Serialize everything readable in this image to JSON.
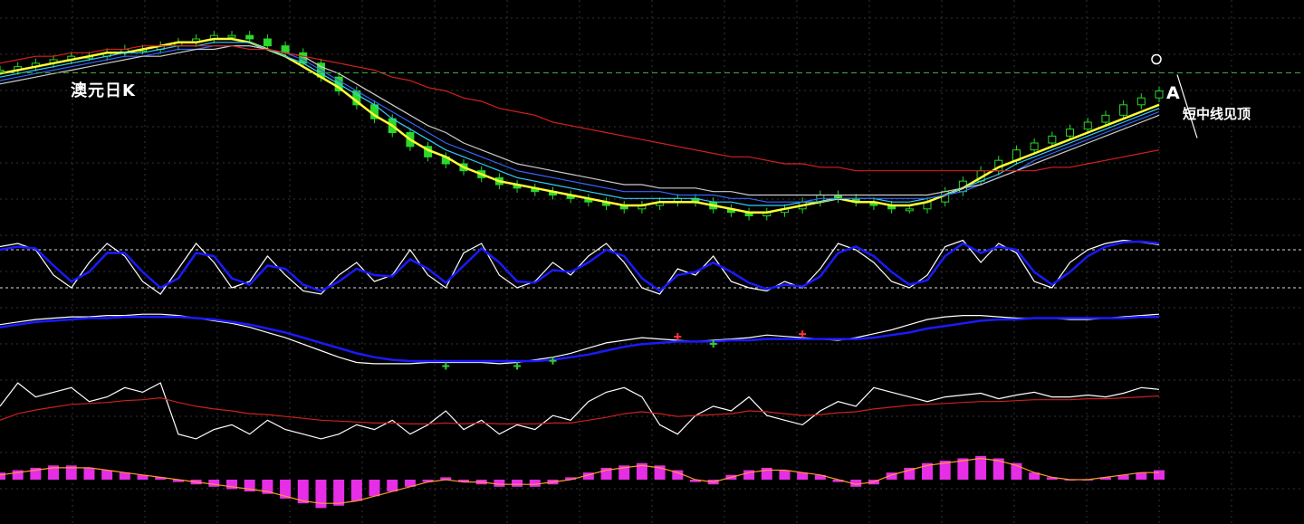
{
  "chart_data": {
    "type": "line",
    "title": "澳元日K",
    "annotations": {
      "point_label": "A",
      "note": "短中线见顶"
    },
    "panels": [
      {
        "name": "price",
        "series": [
          {
            "key": "close",
            "color": "#2bd92b",
            "values": [
              60,
              61,
              62,
              63,
              64,
              64,
              65,
              66,
              66,
              67,
              68,
              69,
              70,
              70,
              69,
              67,
              65,
              62,
              58,
              54,
              50,
              46,
              42,
              38,
              35,
              33,
              31,
              29,
              27,
              26,
              25,
              24,
              23,
              22,
              21,
              20,
              21,
              22,
              23,
              22,
              20,
              19,
              18,
              19,
              20,
              22,
              24,
              23,
              22,
              21,
              20,
              20,
              22,
              25,
              28,
              31,
              34,
              37,
              39,
              41,
              43,
              45,
              47,
              50,
              52,
              54
            ]
          },
          {
            "key": "ma_yellow",
            "color": "#ffff33",
            "values": [
              59,
              60,
              61,
              62,
              63,
              64,
              65,
              65,
              66,
              67,
              68,
              68,
              69,
              69,
              68,
              66,
              64,
              61,
              58,
              55,
              51,
              47,
              44,
              40,
              37,
              35,
              32,
              30,
              28,
              27,
              26,
              25,
              24,
              23,
              22,
              21,
              21,
              22,
              22,
              22,
              21,
              20,
              19,
              19,
              20,
              21,
              22,
              23,
              22,
              22,
              21,
              21,
              22,
              24,
              26,
              29,
              32,
              34,
              36,
              38,
              40,
              42,
              44,
              46,
              48,
              50
            ]
          },
          {
            "key": "ma_cyan",
            "color": "#33ccff",
            "values": [
              58,
              59,
              60,
              61,
              62,
              63,
              64,
              65,
              65,
              66,
              67,
              67,
              68,
              68,
              68,
              66,
              64,
              62,
              59,
              56,
              53,
              50,
              46,
              43,
              40,
              37,
              35,
              33,
              31,
              29,
              28,
              27,
              26,
              25,
              24,
              23,
              23,
              23,
              23,
              23,
              22,
              22,
              21,
              21,
              21,
              22,
              22,
              23,
              23,
              23,
              22,
              22,
              23,
              24,
              26,
              28,
              30,
              33,
              35,
              37,
              39,
              41,
              43,
              45,
              47,
              49
            ]
          },
          {
            "key": "ma_blue",
            "color": "#3366ff",
            "values": [
              57,
              58,
              59,
              60,
              61,
              62,
              63,
              64,
              64,
              65,
              66,
              66,
              67,
              67,
              67,
              66,
              65,
              63,
              60,
              57,
              54,
              51,
              48,
              45,
              42,
              39,
              37,
              35,
              33,
              31,
              30,
              29,
              28,
              27,
              26,
              25,
              25,
              25,
              24,
              24,
              24,
              23,
              23,
              22,
              22,
              22,
              23,
              23,
              23,
              23,
              23,
              23,
              23,
              24,
              25,
              27,
              29,
              31,
              34,
              36,
              38,
              40,
              42,
              44,
              46,
              48
            ]
          },
          {
            "key": "ma_white",
            "color": "#cccccc",
            "values": [
              56,
              57,
              58,
              59,
              60,
              61,
              62,
              63,
              64,
              64,
              65,
              66,
              66,
              67,
              67,
              66,
              65,
              64,
              61,
              59,
              56,
              53,
              50,
              47,
              44,
              42,
              39,
              37,
              35,
              33,
              32,
              31,
              30,
              29,
              28,
              27,
              27,
              26,
              26,
              26,
              25,
              25,
              24,
              24,
              24,
              24,
              24,
              24,
              24,
              24,
              24,
              24,
              24,
              25,
              26,
              27,
              29,
              31,
              33,
              35,
              37,
              39,
              41,
              43,
              45,
              47
            ]
          },
          {
            "key": "ma_red",
            "color": "#d42020",
            "values": [
              62,
              63,
              64,
              64,
              65,
              65,
              66,
              66,
              67,
              67,
              67,
              67,
              67,
              67,
              66,
              66,
              65,
              64,
              63,
              62,
              61,
              60,
              58,
              57,
              55,
              54,
              52,
              51,
              49,
              48,
              47,
              45,
              44,
              43,
              42,
              41,
              40,
              39,
              38,
              37,
              36,
              35,
              35,
              34,
              33,
              33,
              32,
              32,
              31,
              31,
              31,
              31,
              31,
              31,
              31,
              31,
              31,
              31,
              31,
              32,
              32,
              33,
              34,
              35,
              36,
              37
            ]
          }
        ]
      },
      {
        "name": "stochastic",
        "series": [
          {
            "key": "fast",
            "color": "#ffffff",
            "values": [
              85,
              90,
              80,
              40,
              20,
              60,
              90,
              70,
              30,
              10,
              50,
              90,
              60,
              20,
              30,
              70,
              40,
              15,
              10,
              40,
              60,
              30,
              40,
              80,
              40,
              20,
              75,
              90,
              40,
              20,
              30,
              60,
              40,
              70,
              90,
              60,
              20,
              10,
              50,
              40,
              70,
              30,
              20,
              15,
              30,
              20,
              50,
              90,
              80,
              60,
              30,
              20,
              40,
              85,
              95,
              60,
              90,
              75,
              30,
              20,
              60,
              80,
              90,
              95,
              92,
              88
            ]
          },
          {
            "key": "slow",
            "color": "#1a1aff",
            "values": [
              80,
              85,
              82,
              55,
              30,
              45,
              75,
              75,
              45,
              20,
              35,
              75,
              70,
              35,
              25,
              55,
              50,
              25,
              15,
              30,
              50,
              40,
              38,
              65,
              50,
              28,
              55,
              82,
              60,
              30,
              28,
              48,
              45,
              60,
              80,
              70,
              35,
              15,
              40,
              45,
              60,
              45,
              28,
              18,
              25,
              22,
              38,
              75,
              85,
              70,
              45,
              25,
              32,
              70,
              90,
              75,
              85,
              80,
              45,
              25,
              45,
              70,
              85,
              92,
              93,
              90
            ]
          }
        ],
        "reference_lines": [
          80,
          20
        ]
      },
      {
        "name": "trend",
        "series": [
          {
            "key": "fast",
            "color": "#ffffff",
            "values": [
              82,
              84,
              86,
              87,
              88,
              88,
              89,
              89,
              90,
              90,
              89,
              87,
              85,
              83,
              80,
              76,
              72,
              67,
              62,
              57,
              53,
              52,
              52,
              52,
              53,
              53,
              53,
              53,
              52,
              53,
              55,
              57,
              60,
              64,
              68,
              70,
              72,
              71,
              70,
              69,
              70,
              71,
              72,
              74,
              73,
              72,
              71,
              70,
              72,
              75,
              78,
              82,
              86,
              88,
              89,
              89,
              88,
              87,
              87,
              87,
              86,
              86,
              87,
              88,
              89,
              90
            ]
          },
          {
            "key": "slow",
            "color": "#1a1aff",
            "values": [
              80,
              82,
              84,
              85,
              86,
              87,
              87,
              88,
              88,
              88,
              88,
              87,
              86,
              84,
              82,
              79,
              76,
              72,
              68,
              64,
              60,
              57,
              55,
              54,
              54,
              54,
              54,
              54,
              54,
              54,
              54,
              55,
              57,
              59,
              62,
              65,
              67,
              68,
              69,
              69,
              69,
              70,
              70,
              71,
              71,
              71,
              71,
              71,
              71,
              72,
              74,
              76,
              79,
              81,
              83,
              85,
              86,
              86,
              87,
              87,
              87,
              87,
              87,
              87,
              88,
              88
            ]
          }
        ],
        "signals": [
          {
            "index": 38,
            "direction": "up",
            "color": "#ff3333"
          },
          {
            "index": 45,
            "direction": "up",
            "color": "#ff3333"
          },
          {
            "index": 25,
            "direction": "down",
            "color": "#33cc33"
          },
          {
            "index": 29,
            "direction": "down",
            "color": "#33cc33"
          },
          {
            "index": 31,
            "direction": "down",
            "color": "#33cc33"
          },
          {
            "index": 40,
            "direction": "down",
            "color": "#33cc33"
          }
        ]
      },
      {
        "name": "momentum",
        "series": [
          {
            "key": "value",
            "color": "#ffffff",
            "values": [
              60,
              85,
              70,
              75,
              80,
              65,
              70,
              80,
              75,
              85,
              30,
              25,
              35,
              40,
              30,
              45,
              35,
              30,
              25,
              30,
              40,
              35,
              45,
              30,
              40,
              55,
              35,
              45,
              30,
              40,
              35,
              50,
              45,
              65,
              75,
              80,
              70,
              40,
              30,
              50,
              60,
              55,
              70,
              50,
              45,
              40,
              55,
              65,
              60,
              80,
              75,
              70,
              65,
              70,
              72,
              74,
              68,
              72,
              75,
              70,
              70,
              72,
              70,
              74,
              80,
              78
            ]
          },
          {
            "key": "signal",
            "color": "#cc2020",
            "values": [
              45,
              52,
              56,
              59,
              62,
              63,
              64,
              66,
              67,
              69,
              64,
              60,
              57,
              55,
              52,
              51,
              49,
              47,
              45,
              44,
              43,
              42,
              42,
              41,
              41,
              42,
              41,
              42,
              41,
              41,
              41,
              42,
              42,
              45,
              48,
              52,
              54,
              52,
              49,
              50,
              51,
              52,
              55,
              54,
              52,
              50,
              51,
              53,
              54,
              57,
              59,
              61,
              62,
              63,
              64,
              65,
              65,
              66,
              67,
              67,
              67,
              68,
              68,
              69,
              70,
              71
            ]
          }
        ]
      },
      {
        "name": "macd",
        "series": [
          {
            "key": "histogram",
            "color": "#ff33ff",
            "values": [
              3,
              4,
              5,
              6,
              6,
              5,
              4,
              3,
              2,
              1,
              -1,
              -2,
              -3,
              -4,
              -5,
              -6,
              -8,
              -10,
              -12,
              -11,
              -9,
              -7,
              -5,
              -3,
              -1,
              1,
              -1,
              -2,
              -3,
              -3,
              -3,
              -2,
              1,
              3,
              5,
              6,
              7,
              6,
              4,
              -1,
              -2,
              2,
              4,
              5,
              4,
              3,
              2,
              -1,
              -3,
              -2,
              3,
              5,
              7,
              8,
              9,
              10,
              9,
              7,
              3,
              1,
              0,
              0,
              1,
              2,
              3,
              4
            ]
          },
          {
            "key": "signal_line",
            "color": "#ff9933",
            "values": [
              2,
              3,
              4,
              5,
              5,
              5,
              4,
              3,
              2,
              1,
              0,
              -1,
              -2,
              -3,
              -4,
              -5,
              -7,
              -9,
              -10,
              -10,
              -9,
              -7,
              -5,
              -3,
              -1,
              0,
              -1,
              -1,
              -2,
              -2,
              -2,
              -1,
              0,
              2,
              4,
              5,
              6,
              5,
              3,
              0,
              -1,
              1,
              3,
              4,
              4,
              3,
              2,
              0,
              -2,
              -1,
              2,
              4,
              6,
              7,
              8,
              9,
              8,
              6,
              3,
              1,
              0,
              0,
              1,
              2,
              3,
              3
            ]
          }
        ]
      }
    ],
    "grid": true,
    "style": {
      "background": "#000000",
      "grid_color": "#333333",
      "price_level_line_color": "#44aa44"
    }
  }
}
